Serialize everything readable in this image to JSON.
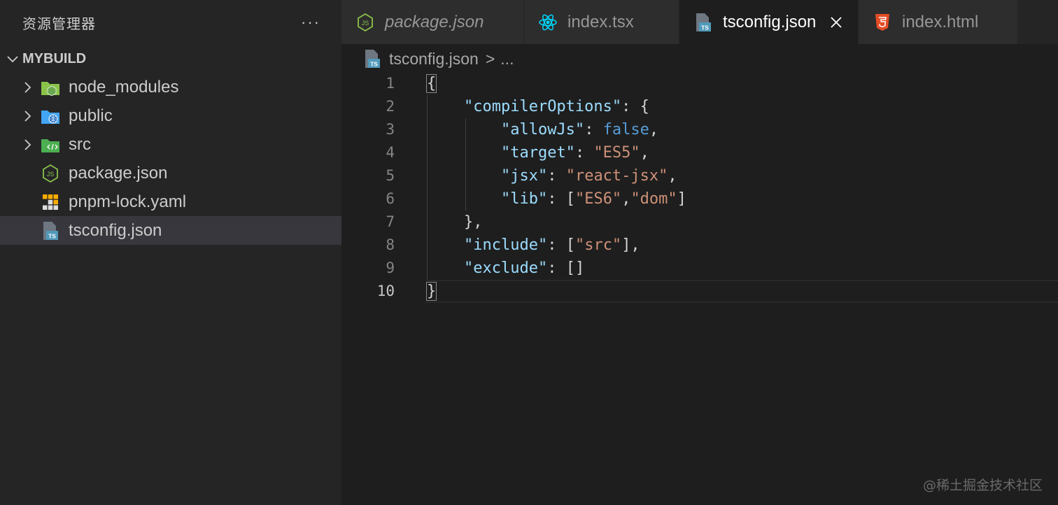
{
  "sidebar": {
    "title": "资源管理器",
    "more_label": "···",
    "project": "MYBUILD",
    "items": [
      {
        "label": "node_modules"
      },
      {
        "label": "public"
      },
      {
        "label": "src"
      },
      {
        "label": "package.json"
      },
      {
        "label": "pnpm-lock.yaml"
      },
      {
        "label": "tsconfig.json"
      }
    ]
  },
  "tabs": [
    {
      "label": "package.json"
    },
    {
      "label": "index.tsx"
    },
    {
      "label": "tsconfig.json"
    },
    {
      "label": "index.html"
    }
  ],
  "breadcrumb": {
    "file": "tsconfig.json",
    "separator": ">",
    "more": "..."
  },
  "editor": {
    "line_numbers": [
      "1",
      "2",
      "3",
      "4",
      "5",
      "6",
      "7",
      "8",
      "9",
      "10"
    ],
    "lines": [
      {
        "p1": "{"
      },
      {
        "k": "\"compilerOptions\"",
        "p1": ": {"
      },
      {
        "k": "\"allowJs\"",
        "p1": ": ",
        "kw": "false",
        "p2": ","
      },
      {
        "k": "\"target\"",
        "p1": ": ",
        "s": "\"ES5\"",
        "p2": ","
      },
      {
        "k": "\"jsx\"",
        "p1": ": ",
        "s": "\"react-jsx\"",
        "p2": ","
      },
      {
        "k": "\"lib\"",
        "p1": ": [",
        "s": "\"ES6\"",
        "p2": ",",
        "s2": "\"dom\"",
        "p3": "]"
      },
      {
        "p1": "},"
      },
      {
        "k": "\"include\"",
        "p1": ": [",
        "s": "\"src\"",
        "p2": "],"
      },
      {
        "k": "\"exclude\"",
        "p1": ": []"
      },
      {
        "p1": "}"
      }
    ]
  },
  "watermark": "@稀土掘金技术社区",
  "colors": {
    "editor_bg": "#1e1e1e",
    "sidebar_bg": "#252526",
    "key": "#9cdcfe",
    "string": "#ce9178",
    "keyword": "#569cd6",
    "ts_icon": "#519aba",
    "node_green": "#8bc34a",
    "react_blue": "#00d8ff",
    "html_orange": "#e44d26"
  }
}
